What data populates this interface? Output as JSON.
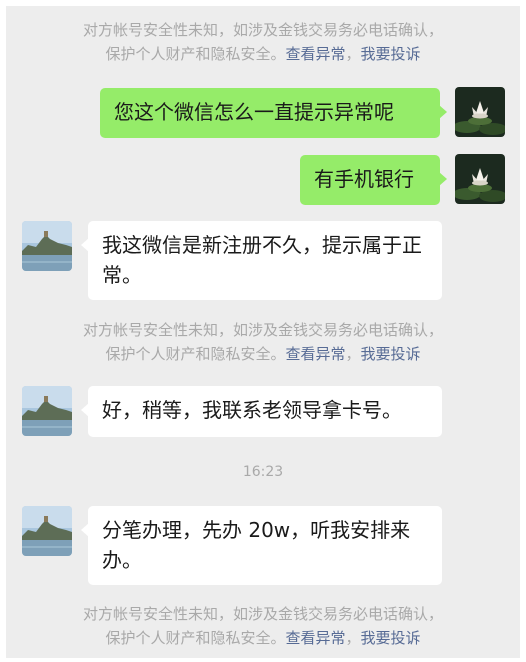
{
  "security_notice": {
    "line1": "对方帐号安全性未知，如涉及金钱交易务必电话确认，",
    "line2_prefix": "保护个人财产和隐私安全。",
    "view_abnormal": "查看异常",
    "separator": "，",
    "complain": "我要投诉"
  },
  "messages": [
    {
      "sender": "me",
      "text": "您这个微信怎么一直提示异常呢"
    },
    {
      "sender": "me",
      "text": "有手机银行"
    },
    {
      "sender": "contact",
      "text": "我这微信是新注册不久，提示属于正常。"
    },
    {
      "sender": "contact",
      "text": "好，稍等，我联系老领导拿卡号。"
    },
    {
      "sender": "contact",
      "text": "分笔办理，先办 20w，听我安排来办。"
    }
  ],
  "timestamp": "16:23",
  "avatars": {
    "me": "lotus-flower-avatar",
    "contact": "lakeside-pagoda-avatar"
  }
}
